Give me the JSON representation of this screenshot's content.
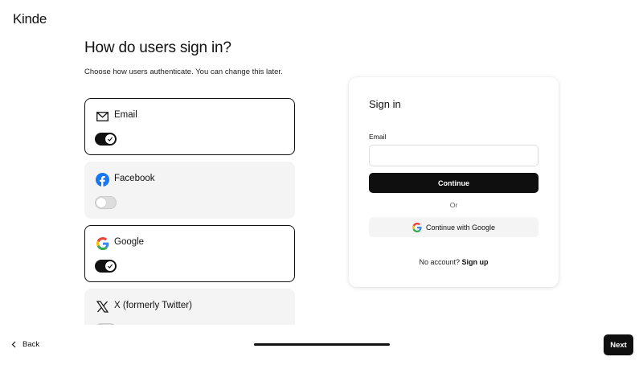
{
  "brand": {
    "logo_text": "Kinde"
  },
  "page": {
    "title": "How do users sign in?",
    "subtitle": "Choose how users authenticate. You can change this later."
  },
  "auth_options": [
    {
      "label": "Email",
      "icon": "mail-icon",
      "enabled": true
    },
    {
      "label": "Facebook",
      "icon": "facebook-icon",
      "enabled": false
    },
    {
      "label": "Google",
      "icon": "google-icon",
      "enabled": true
    },
    {
      "label": "X (formerly Twitter)",
      "icon": "x-icon",
      "enabled": false
    }
  ],
  "preview": {
    "title": "Sign in",
    "email_label": "Email",
    "email_value": "",
    "continue_label": "Continue",
    "or_label": "Or",
    "google_label": "Continue with Google",
    "no_account_text": "No account?",
    "signup_label": "Sign up"
  },
  "footer": {
    "back_label": "Back",
    "next_label": "Next",
    "progress": 1.0
  },
  "colors": {
    "primary": "#0f0f0f",
    "selected_border": "#111111",
    "option_bg": "#f4f4f4",
    "facebook_blue": "#1877f2"
  }
}
